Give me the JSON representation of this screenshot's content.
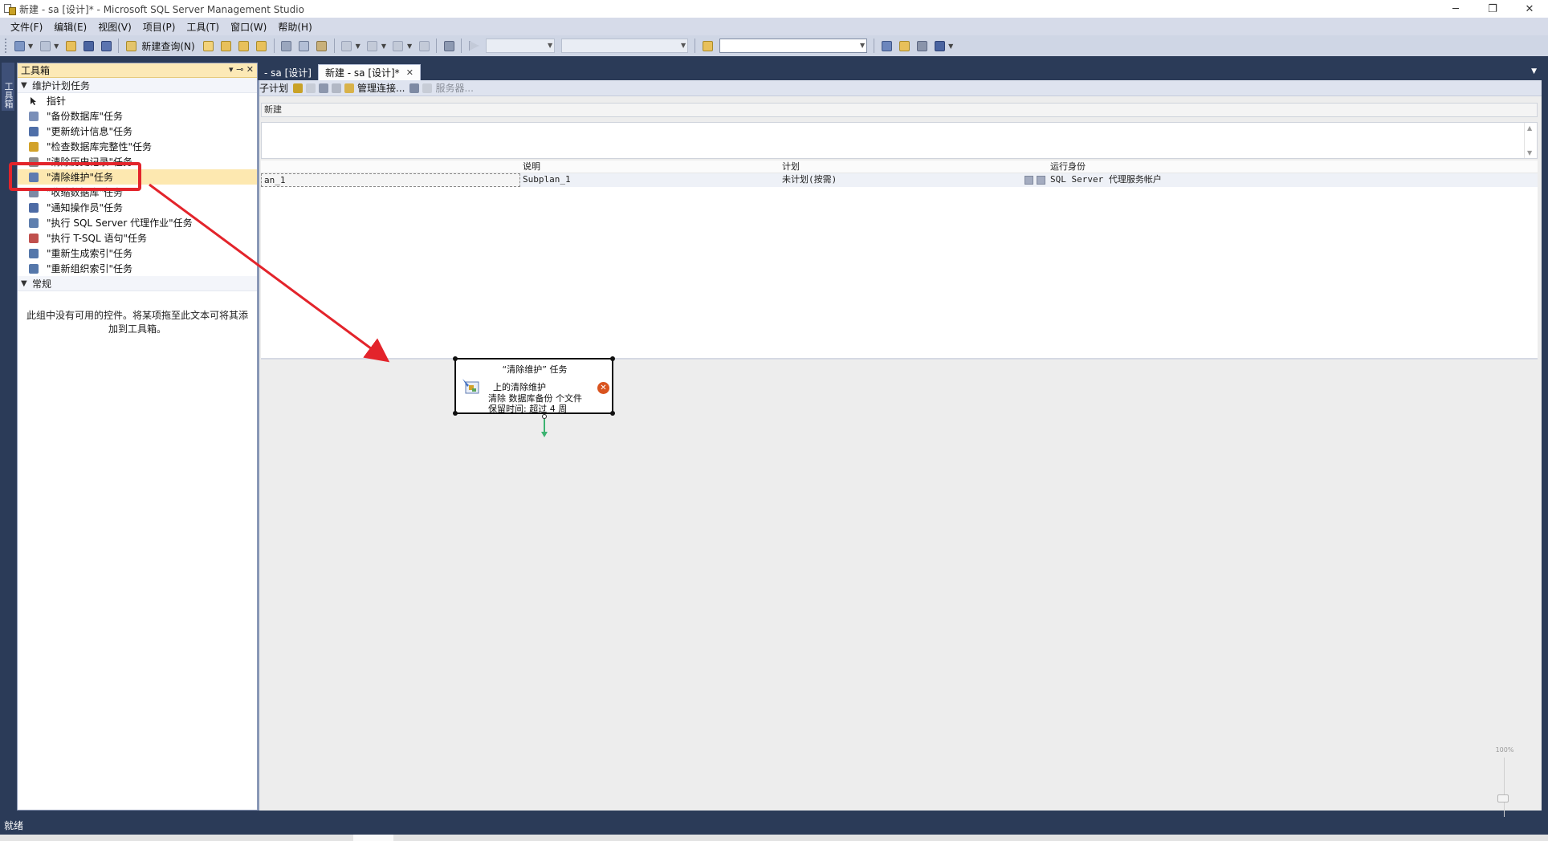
{
  "window": {
    "title": "新建 - sa [设计]* - Microsoft SQL Server Management Studio",
    "minimize": "─",
    "restore": "❐",
    "close": "✕"
  },
  "menu": [
    "文件(F)",
    "编辑(E)",
    "视图(V)",
    "项目(P)",
    "工具(T)",
    "窗口(W)",
    "帮助(H)"
  ],
  "toolbar": {
    "new_query_label": "新建查询(N)"
  },
  "left_strip": {
    "tab_label": "工具箱"
  },
  "toolbox": {
    "title": "工具箱",
    "pin": "▾ ⊸ ✕",
    "group1": {
      "label": "维护计划任务",
      "items": [
        {
          "label": "指针",
          "icon": "pointer-icon",
          "color": "#222222"
        },
        {
          "label": "\"备份数据库\"任务",
          "icon": "backup-database-icon",
          "color": "#7a8fb8"
        },
        {
          "label": "\"更新统计信息\"任务",
          "icon": "update-statistics-icon",
          "color": "#4f6fa8"
        },
        {
          "label": "\"检查数据库完整性\"任务",
          "icon": "check-integrity-icon",
          "color": "#d2a22a"
        },
        {
          "label": "\"清除历史记录\"任务",
          "icon": "history-cleanup-icon",
          "color": "#8b8b8b"
        },
        {
          "label": "\"清除维护\"任务",
          "icon": "maintenance-cleanup-icon",
          "color": "#5d7ab0"
        },
        {
          "label": "\"收缩数据库\"任务",
          "icon": "shrink-database-icon",
          "color": "#7d8aa5"
        },
        {
          "label": "\"通知操作员\"任务",
          "icon": "notify-operator-icon",
          "color": "#4d6ba5"
        },
        {
          "label": "\"执行 SQL Server 代理作业\"任务",
          "icon": "agent-job-icon",
          "color": "#5f7fae"
        },
        {
          "label": "\"执行 T-SQL 语句\"任务",
          "icon": "tsql-icon",
          "color": "#c0504d"
        },
        {
          "label": "\"重新生成索引\"任务",
          "icon": "rebuild-index-icon",
          "color": "#5577aa"
        },
        {
          "label": "\"重新组织索引\"任务",
          "icon": "reorganize-index-icon",
          "color": "#5577aa"
        }
      ]
    },
    "group2": {
      "label": "常规",
      "empty_text": "此组中没有可用的控件。将某项拖至此文本可将其添加到工具箱。"
    }
  },
  "doc_tabs": [
    {
      "label": "- sa [设计]",
      "active": false
    },
    {
      "label": "新建 - sa [设计]*",
      "active": true
    }
  ],
  "designer_toolbar": {
    "add_subplan": "子计划",
    "manage_connections": "管理连接...",
    "servers": "服务器..."
  },
  "plan": {
    "name": "新建",
    "columns": [
      "",
      "说明",
      "计划",
      "",
      "运行身份"
    ],
    "rows": [
      {
        "name": "an_1",
        "description": "Subplan_1",
        "schedule": "未计划(按需)",
        "run_as": "SQL Server 代理服务帐户"
      }
    ]
  },
  "task": {
    "title": "“清除维护” 任务",
    "line1": "上的清除维护",
    "line2": "清除 数据库备份 个文件",
    "line3": "保留时间: 超过 4 周",
    "error_mark": "✕"
  },
  "zoom": {
    "label": "100%"
  },
  "status": {
    "text": "就绪"
  },
  "colors": {
    "highlight": "#e3242b",
    "chrome": "#2b3b58",
    "toolbox_header": "#fce9b6",
    "error": "#d9531e",
    "connector": "#3cb371"
  }
}
